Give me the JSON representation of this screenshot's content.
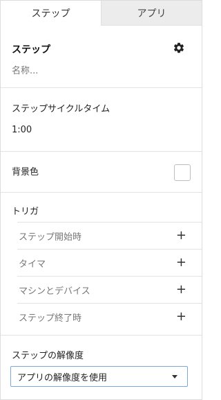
{
  "tabs": [
    {
      "label": "ステップ",
      "active": true
    },
    {
      "label": "アプリ",
      "active": false
    }
  ],
  "step": {
    "title": "ステップ",
    "name_placeholder": "名称..."
  },
  "cycle_time": {
    "label": "ステップサイクルタイム",
    "value": "1:00"
  },
  "background": {
    "label": "背景色",
    "color": "#ffffff"
  },
  "trigger": {
    "label": "トリガ",
    "items": [
      {
        "label": "ステップ開始時",
        "action_icon": "+"
      },
      {
        "label": "タイマ",
        "action_icon": "+"
      },
      {
        "label": "マシンとデバイス",
        "action_icon": "+"
      },
      {
        "label": "ステップ終了時",
        "action_icon": "+"
      }
    ]
  },
  "resolution": {
    "label": "ステップの解像度",
    "selected": "アプリの解像度を使用"
  },
  "colors": {
    "accent": "#4a7ebf",
    "tab_inactive_bg": "#ececec",
    "divider": "#e3e3e3"
  }
}
